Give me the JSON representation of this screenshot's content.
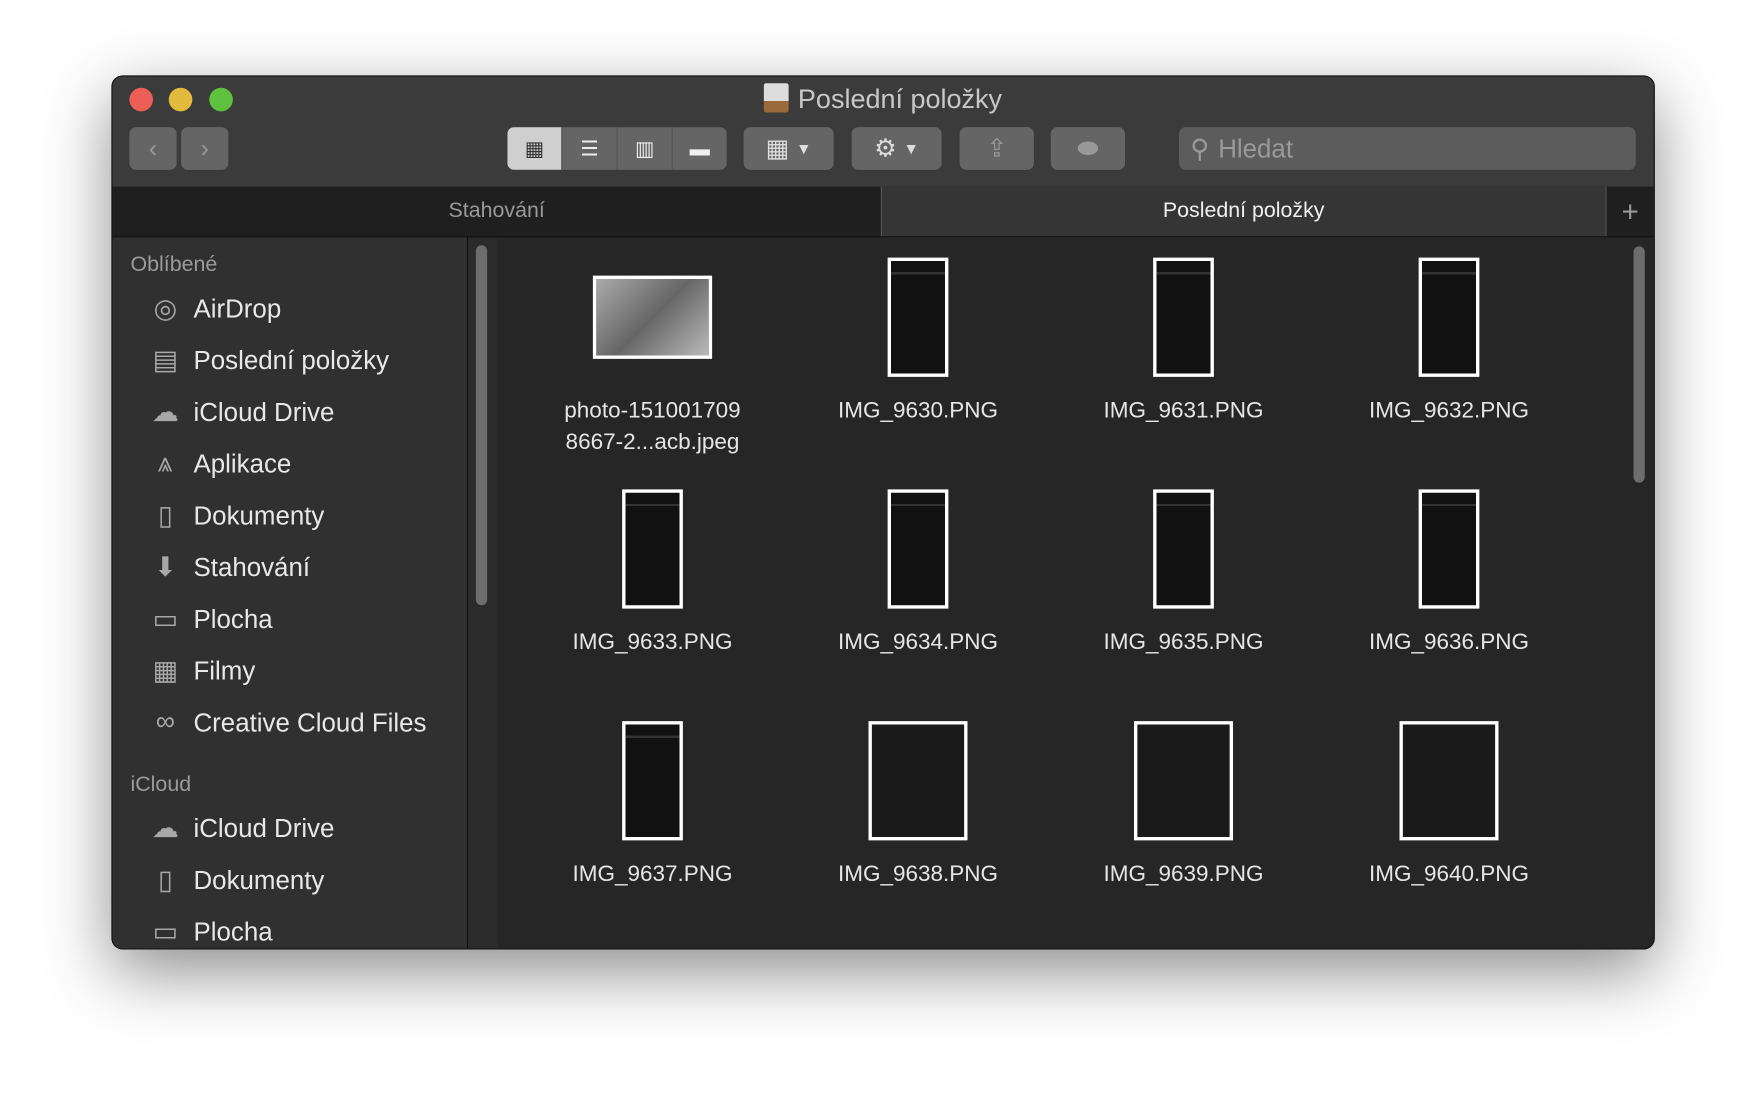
{
  "window": {
    "title": "Poslední položky"
  },
  "toolbar": {
    "back": "‹",
    "forward": "›",
    "search_placeholder": "Hledat"
  },
  "tabs": [
    {
      "label": "Stahování"
    },
    {
      "label": "Poslední položky"
    }
  ],
  "tab_add": "+",
  "sidebar": {
    "favorites_header": "Oblíbené",
    "favorites": [
      {
        "label": "AirDrop",
        "icon": "◎"
      },
      {
        "label": "Poslední položky",
        "icon": "▤"
      },
      {
        "label": "iCloud Drive",
        "icon": "☁"
      },
      {
        "label": "Aplikace",
        "icon": "⩓"
      },
      {
        "label": "Dokumenty",
        "icon": "▯"
      },
      {
        "label": "Stahování",
        "icon": "⬇"
      },
      {
        "label": "Plocha",
        "icon": "▭"
      },
      {
        "label": "Filmy",
        "icon": "▦"
      },
      {
        "label": "Creative Cloud Files",
        "icon": "∞"
      }
    ],
    "icloud_header": "iCloud",
    "icloud": [
      {
        "label": "iCloud Drive",
        "icon": "☁"
      },
      {
        "label": "Dokumenty",
        "icon": "▯"
      },
      {
        "label": "Plocha",
        "icon": "▭"
      }
    ]
  },
  "files": [
    {
      "name": "photo-151001709\n8667-2...acb.jpeg",
      "kind": "photo"
    },
    {
      "name": "IMG_9630.PNG",
      "kind": "phone"
    },
    {
      "name": "IMG_9631.PNG",
      "kind": "phone"
    },
    {
      "name": "IMG_9632.PNG",
      "kind": "phone"
    },
    {
      "name": "IMG_9633.PNG",
      "kind": "phone"
    },
    {
      "name": "IMG_9634.PNG",
      "kind": "phone"
    },
    {
      "name": "IMG_9635.PNG",
      "kind": "phone"
    },
    {
      "name": "IMG_9636.PNG",
      "kind": "phone"
    },
    {
      "name": "IMG_9637.PNG",
      "kind": "phone"
    },
    {
      "name": "IMG_9638.PNG",
      "kind": "watch"
    },
    {
      "name": "IMG_9639.PNG",
      "kind": "watch"
    },
    {
      "name": "IMG_9640.PNG",
      "kind": "watch"
    }
  ]
}
